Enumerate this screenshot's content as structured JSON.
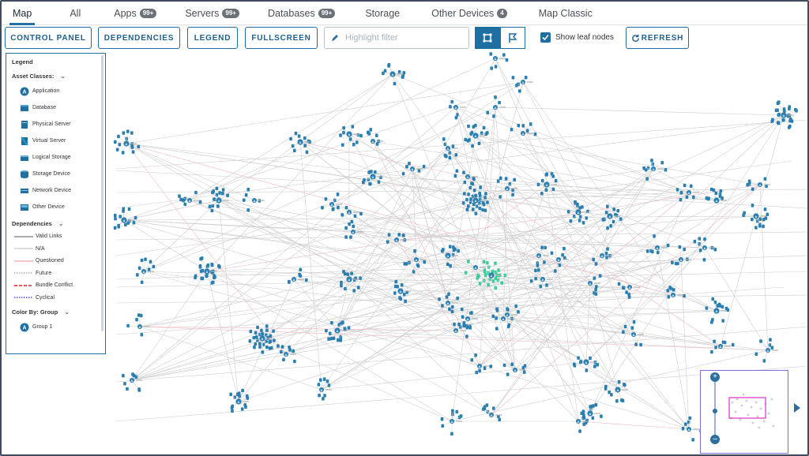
{
  "tabs": [
    {
      "label": "Map",
      "badge": ""
    },
    {
      "label": "All",
      "badge": ""
    },
    {
      "label": "Apps",
      "badge": "99+"
    },
    {
      "label": "Servers",
      "badge": "99+"
    },
    {
      "label": "Databases",
      "badge": "99+"
    },
    {
      "label": "Storage",
      "badge": ""
    },
    {
      "label": "Other Devices",
      "badge": "4"
    },
    {
      "label": "Map Classic",
      "badge": ""
    }
  ],
  "toolbar": {
    "control_panel": "CONTROL PANEL",
    "dependencies": "DEPENDENCIES",
    "legend": "LEGEND",
    "fullscreen": "FULLSCREEN",
    "highlight_placeholder": "Highlight filter",
    "show_leaf_nodes": "Show leaf nodes",
    "refresh": "REFRESH"
  },
  "legend": {
    "title": "Legend",
    "asset_classes_label": "Asset Classes:",
    "asset_classes": [
      {
        "label": "Application",
        "icon": "application-icon"
      },
      {
        "label": "Database",
        "icon": "database-icon"
      },
      {
        "label": "Physical Server",
        "icon": "physical-server-icon"
      },
      {
        "label": "Virtual Server",
        "icon": "virtual-server-icon"
      },
      {
        "label": "Logical Storage",
        "icon": "logical-storage-icon"
      },
      {
        "label": "Storage Device",
        "icon": "storage-device-icon"
      },
      {
        "label": "Network Device",
        "icon": "network-device-icon"
      },
      {
        "label": "Other Device",
        "icon": "other-device-icon"
      }
    ],
    "dependencies_label": "Dependencies",
    "dependencies": [
      {
        "label": "Valid Links",
        "color": "#7a7a7a",
        "style": "solid"
      },
      {
        "label": "N/A",
        "color": "#c8c8c8",
        "style": "solid"
      },
      {
        "label": "Questioned",
        "color": "#f2a3a3",
        "style": "solid"
      },
      {
        "label": "Future",
        "color": "#a0a0a0",
        "style": "dotted"
      },
      {
        "label": "Bundle Conflict",
        "color": "#e02020",
        "style": "dashed"
      },
      {
        "label": "Cyclical",
        "color": "#2a2ae0",
        "style": "dotted"
      }
    ],
    "color_by_label": "Color By: Group",
    "groups": [
      {
        "label": "Group 1",
        "icon": "application-icon"
      }
    ]
  },
  "colors": {
    "accent": "#1f6fa3",
    "node": "#2a7fb0",
    "node_green": "#3ccf9a",
    "edge": "#cfcfcf"
  }
}
